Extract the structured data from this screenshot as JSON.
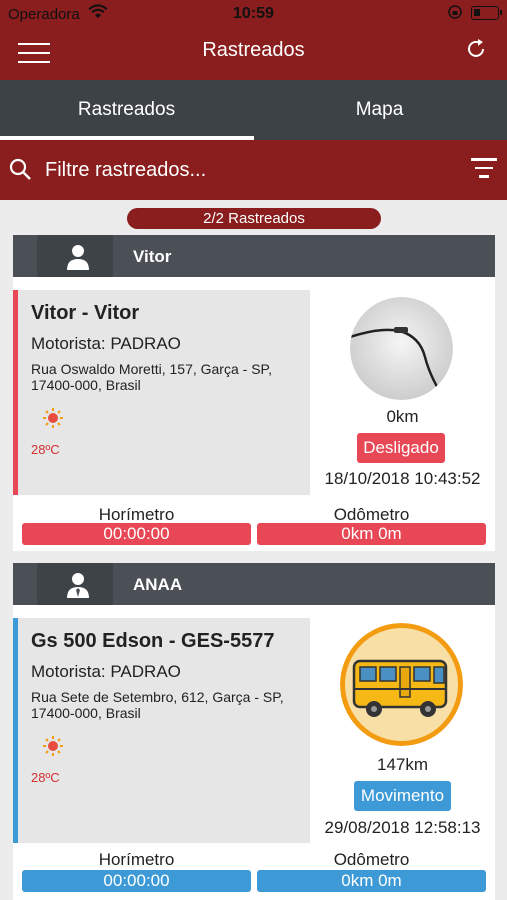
{
  "status_bar": {
    "carrier": "Operadora",
    "time": "10:59"
  },
  "header": {
    "title": "Rastreados"
  },
  "tabs": [
    {
      "label": "Rastreados"
    },
    {
      "label": "Mapa"
    }
  ],
  "search": {
    "placeholder": "Filtre rastreados..."
  },
  "summary": {
    "count": "2/2 Rastreados"
  },
  "colors": {
    "brand": "#8a1d1d",
    "tab_bar": "#3d4246",
    "off": "#e84855",
    "moving": "#3d9ad6"
  },
  "trackers": [
    {
      "group": "Vitor",
      "vehicle": "Vitor - Vitor",
      "driver": "Motorista: PADRAO",
      "address": "Rua Oswaldo Moretti, 157, Garça - SP, 17400-000, Brasil",
      "temperature": "28ºC",
      "distance": "0km",
      "status": "Desligado",
      "timestamp": "18/10/2018 10:43:52",
      "hour_meter_label": "Horímetro",
      "hour_meter": "00:00:00",
      "odometer_label": "Odômetro",
      "odometer": "0km 0m"
    },
    {
      "group": "ANAA",
      "vehicle": "Gs 500 Edson - GES-5577",
      "driver": "Motorista: PADRAO",
      "address": "Rua Sete de Setembro, 612, Garça - SP, 17400-000, Brasil",
      "temperature": "28ºC",
      "distance": "147km",
      "status": "Movimento",
      "timestamp": "29/08/2018 12:58:13",
      "hour_meter_label": "Horímetro",
      "hour_meter": "00:00:00",
      "odometer_label": "Odômetro",
      "odometer": "0km 0m"
    }
  ]
}
